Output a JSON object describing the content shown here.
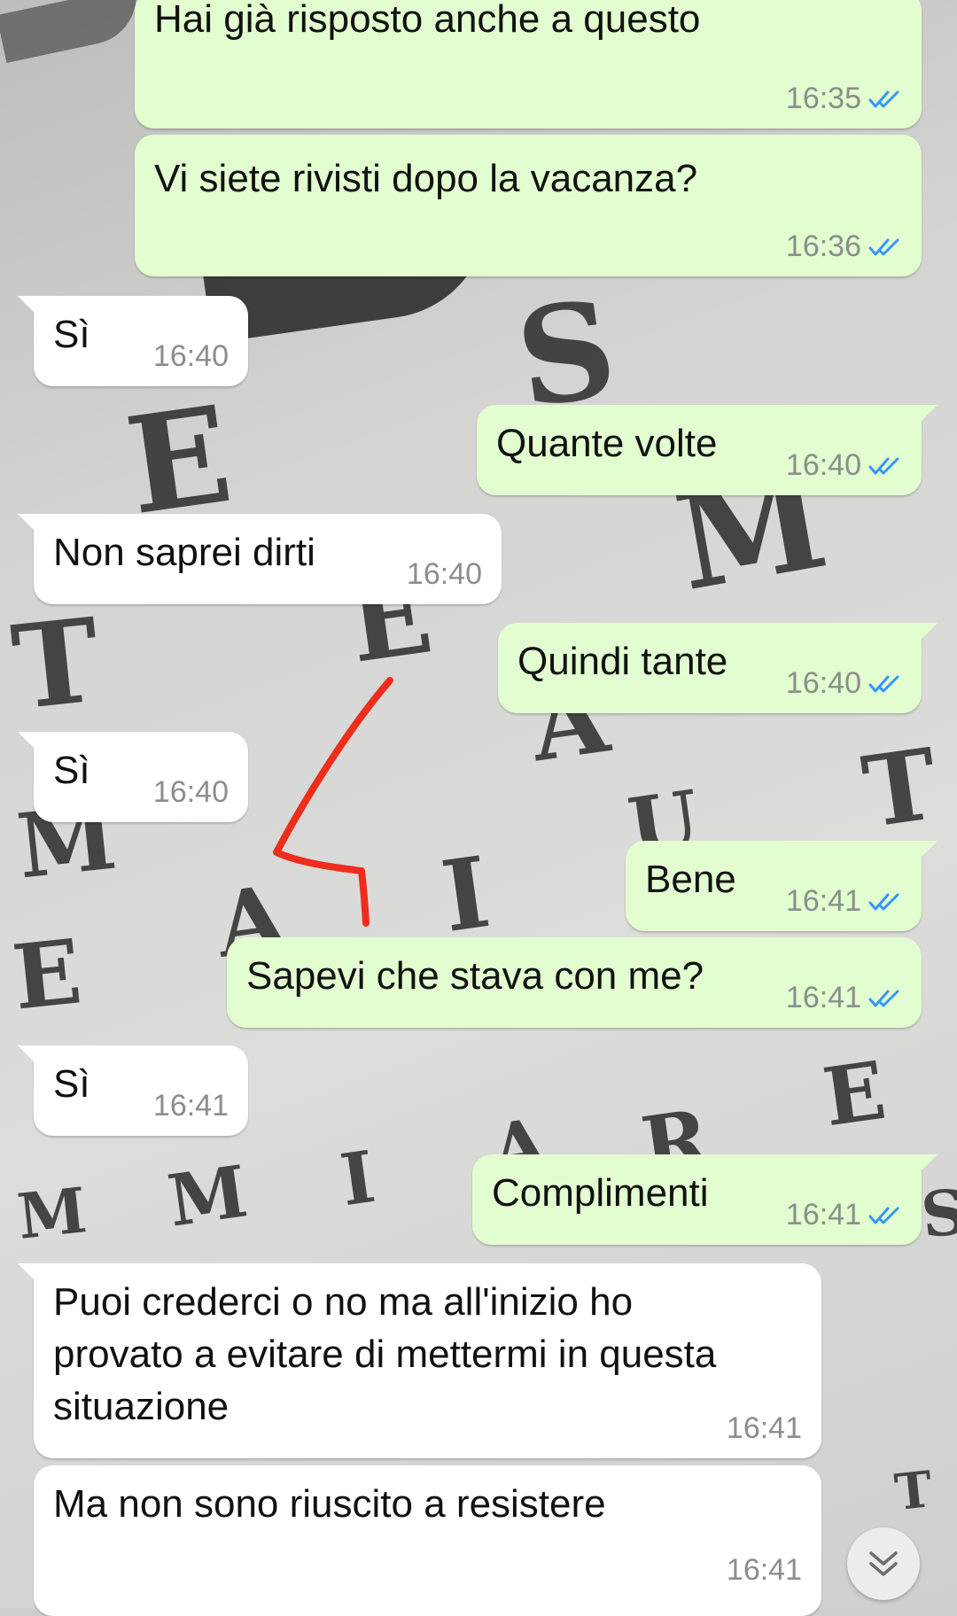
{
  "chat": {
    "messages": [
      {
        "dir": "out",
        "text": "Hai già risposto anche a questo",
        "time": "16:35",
        "read": true
      },
      {
        "dir": "out",
        "text": "Vi siete rivisti dopo la vacanza?",
        "time": "16:36",
        "read": true
      },
      {
        "dir": "in",
        "text": "Sì",
        "time": "16:40"
      },
      {
        "dir": "out",
        "text": "Quante volte",
        "time": "16:40",
        "read": true
      },
      {
        "dir": "in",
        "text": "Non saprei dirti",
        "time": "16:40"
      },
      {
        "dir": "out",
        "text": "Quindi tante",
        "time": "16:40",
        "read": true
      },
      {
        "dir": "in",
        "text": "Sì",
        "time": "16:40"
      },
      {
        "dir": "out",
        "text": "Bene",
        "time": "16:41",
        "read": true
      },
      {
        "dir": "out",
        "text": "Sapevi che stava con me?",
        "time": "16:41",
        "read": true
      },
      {
        "dir": "in",
        "text": "Sì",
        "time": "16:41"
      },
      {
        "dir": "out",
        "text": "Complimenti",
        "time": "16:41",
        "read": true
      },
      {
        "dir": "in",
        "text": "Puoi crederci o no ma all'inizio ho provato a evitare di mettermi in questa situazione",
        "time": "16:41"
      },
      {
        "dir": "in",
        "text": "Ma non sono riuscito a resistere",
        "time": "16:41"
      }
    ]
  },
  "colors": {
    "outgoing_bubble": "#e2fdcf",
    "incoming_bubble": "#ffffff",
    "read_check": "#3497f9",
    "annotation_stroke": "#ee2d1c"
  },
  "icons": {
    "read_receipt": "double-check-icon",
    "scroll_down": "chevron-double-down-icon"
  }
}
